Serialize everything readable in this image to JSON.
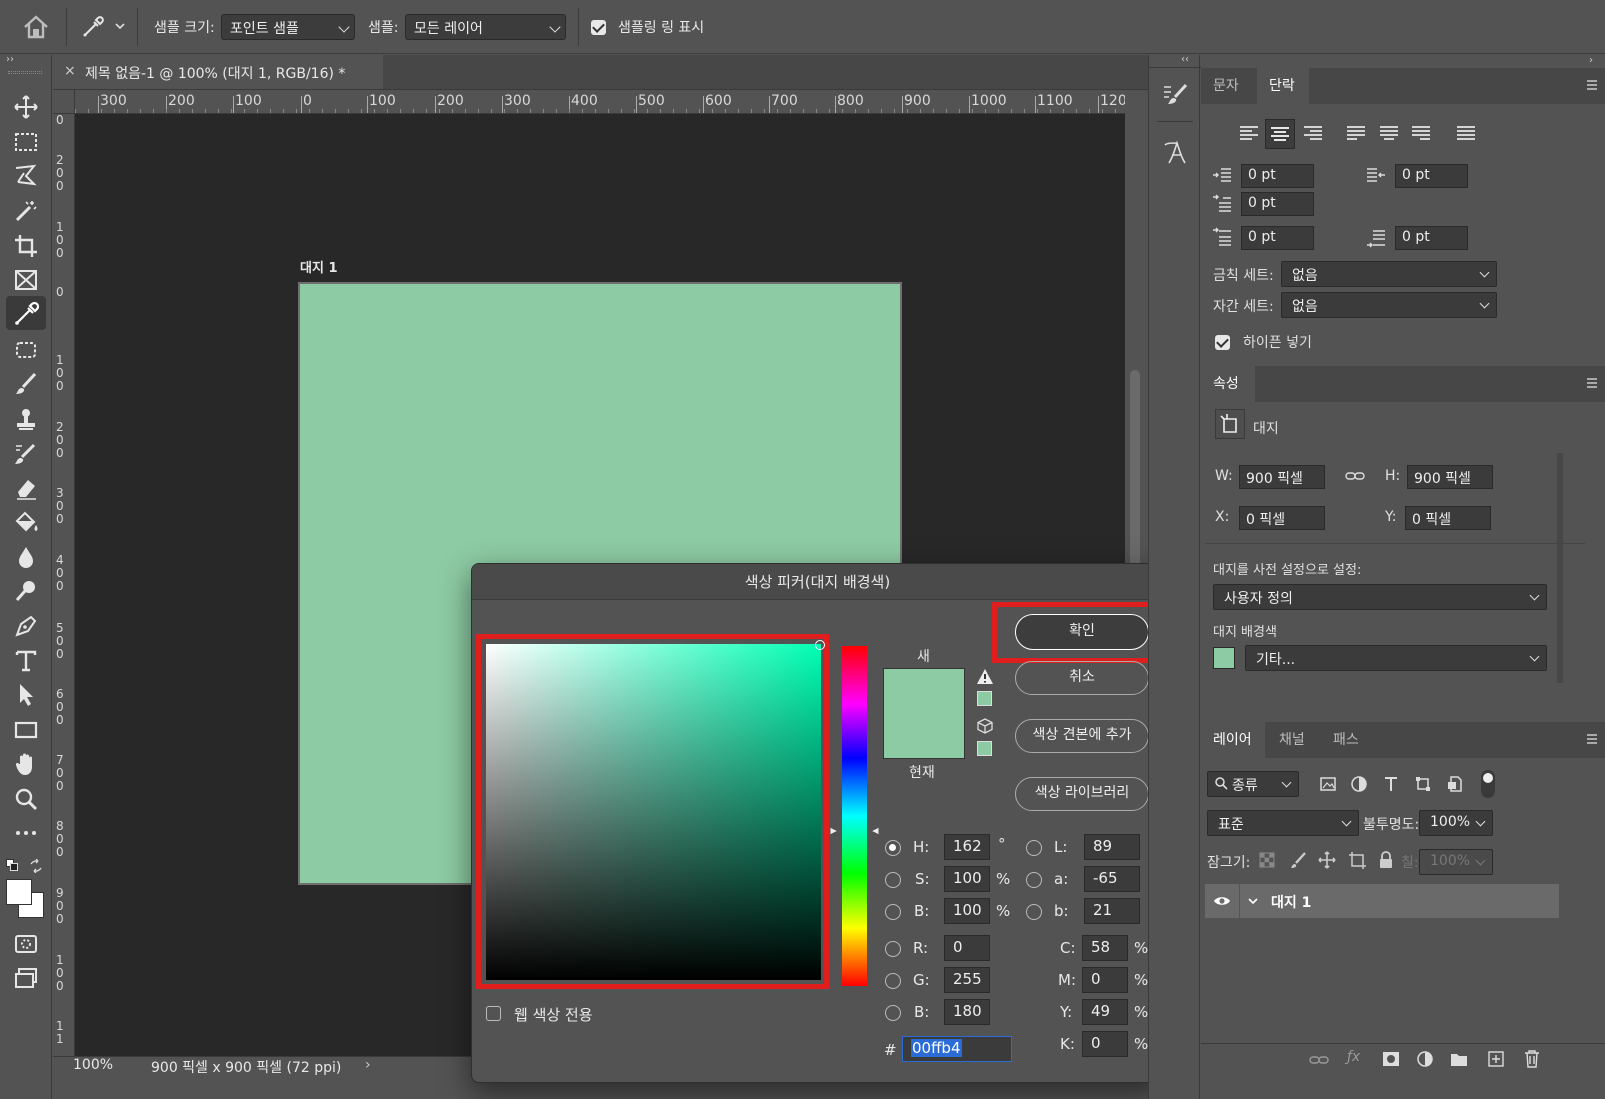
{
  "options_bar": {
    "sample_size_label": "샘플 크기:",
    "sample_size_value": "포인트 샘플",
    "sample_label": "샘플:",
    "sample_value": "모든 레이어",
    "show_ring_label": "샘플링 링 표시"
  },
  "document": {
    "tab_title": "제목 없음-1 @ 100% (대지 1, RGB/16) *",
    "artboard_label": "대지 1",
    "artboard_color": "#8dcba4",
    "ruler_h": [
      "300",
      "200",
      "100",
      "0",
      "100",
      "200",
      "300",
      "400",
      "500",
      "600",
      "700",
      "800",
      "900",
      "1000",
      "1100",
      "120"
    ],
    "ruler_v": [
      "0",
      "2\n0\n0",
      "1\n0\n0",
      "0",
      "1\n0\n0",
      "2\n0\n0",
      "3\n0\n0",
      "4\n0\n0",
      "5\n0\n0",
      "6\n0\n0",
      "7\n0\n0",
      "8\n0\n0",
      "9\n0\n0",
      "1\n0\n0",
      "1\n1"
    ]
  },
  "status": {
    "zoom": "100%",
    "doc_info": "900 픽셀 x 900 픽셀 (72 ppi)"
  },
  "color_picker": {
    "title": "색상 피커(대지 배경색)",
    "ok_label": "확인",
    "cancel_label": "취소",
    "add_swatch_label": "색상 견본에 추가",
    "libraries_label": "색상 라이브러리",
    "new_label": "새",
    "current_label": "현재",
    "web_only_label": "웹 색상 전용",
    "new_color": "#8dcba4",
    "current_color": "#8dcba4",
    "hsb": {
      "h_label": "H:",
      "h": "162",
      "h_unit": "°",
      "s_label": "S:",
      "s": "100",
      "s_unit": "%",
      "b_label": "B:",
      "b": "100",
      "b_unit": "%"
    },
    "lab": {
      "l_label": "L:",
      "l": "89",
      "a_label": "a:",
      "a": "-65",
      "b_label": "b:",
      "b": "21"
    },
    "rgb": {
      "r_label": "R:",
      "r": "0",
      "g_label": "G:",
      "g": "255",
      "b_label": "B:",
      "b": "180"
    },
    "cmyk": {
      "c_label": "C:",
      "c": "58",
      "m_label": "M:",
      "m": "0",
      "y_label": "Y:",
      "y": "49",
      "k_label": "K:",
      "k": "0",
      "unit": "%"
    },
    "hex_label": "#",
    "hex": "00ffb4"
  },
  "paragraph_panel": {
    "tabs": [
      "문자",
      "단락"
    ],
    "indent_left": "0 pt",
    "indent_right": "0 pt",
    "indent_first": "0 pt",
    "space_before": "0 pt",
    "space_after": "0 pt",
    "kinsoku_label": "금칙 세트:",
    "kinsoku_value": "없음",
    "mojikumi_label": "자간 세트:",
    "mojikumi_value": "없음",
    "hyphenate_label": "하이픈 넣기"
  },
  "properties_panel": {
    "tab": "속성",
    "type_label": "대지",
    "w_label": "W:",
    "w_value": "900 픽셀",
    "h_label": "H:",
    "h_value": "900 픽셀",
    "x_label": "X:",
    "x_value": "0 픽셀",
    "y_label": "Y:",
    "y_value": "0 픽셀",
    "preset_label": "대지를 사전 설정으로 설정:",
    "preset_value": "사용자 정의",
    "bg_label": "대지 배경색",
    "bg_value": "기타...",
    "bg_swatch": "#8dcba4"
  },
  "layers_panel": {
    "tabs": [
      "레이어",
      "채널",
      "패스"
    ],
    "filter_label": "종류",
    "blend_mode": "표준",
    "opacity_label": "불투명도:",
    "opacity_value": "100%",
    "lock_label": "잠그기:",
    "fill_label": "칠:",
    "fill_value": "100%",
    "layer_name": "대지 1"
  }
}
